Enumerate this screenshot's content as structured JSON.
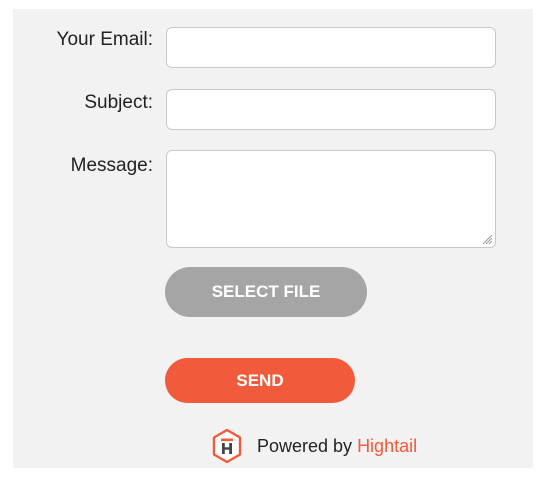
{
  "form": {
    "email_label": "Your Email:",
    "email_value": "",
    "subject_label": "Subject:",
    "subject_value": "",
    "message_label": "Message:",
    "message_value": "",
    "select_file_label": "SELECT FILE",
    "send_label": "SEND"
  },
  "footer": {
    "powered_text": "Powered by",
    "brand": "Hightail",
    "logo_icon": "hightail-logo-icon"
  },
  "colors": {
    "accent": "#f15a3a",
    "secondary_button": "#a5a5a5",
    "panel_background": "#f2f2f2"
  }
}
